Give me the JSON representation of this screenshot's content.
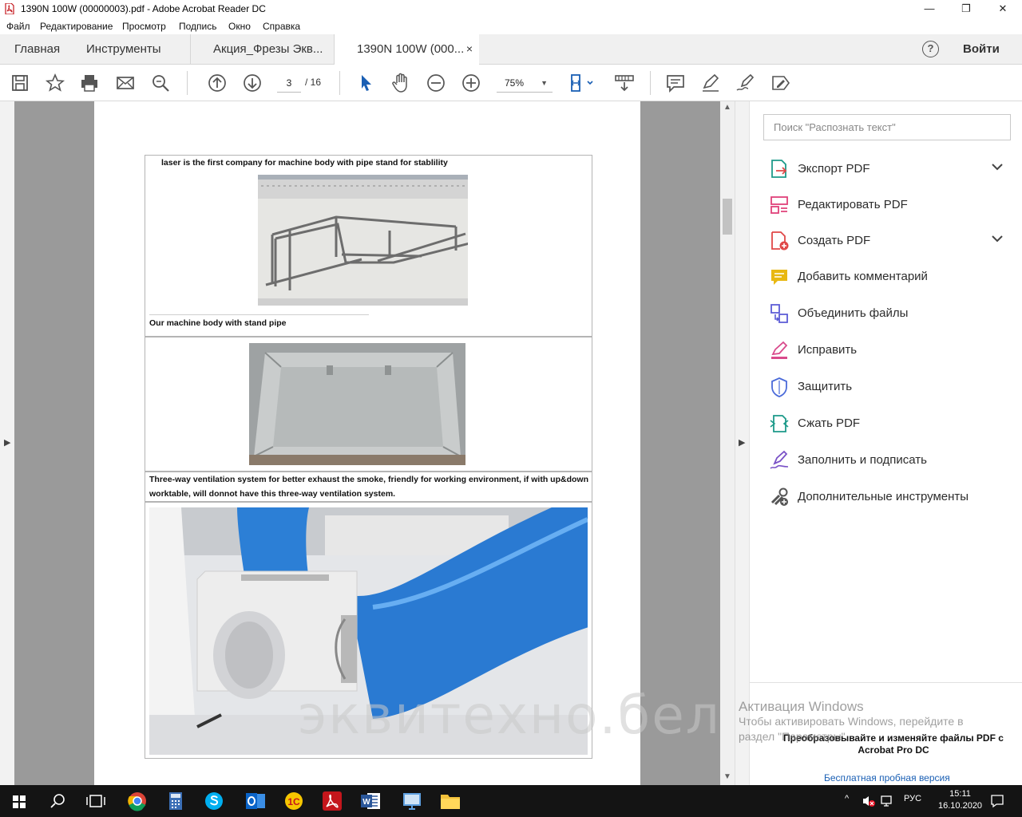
{
  "window": {
    "title": "1390N 100W (00000003).pdf - Adobe Acrobat Reader DC",
    "minimize": "—",
    "maximize": "❐",
    "close": "✕"
  },
  "menu": [
    "Файл",
    "Редактирование",
    "Просмотр",
    "Подпись",
    "Окно",
    "Справка"
  ],
  "tabs": {
    "home": "Главная",
    "tools": "Инструменты",
    "doc1": "Акция_Фрезы Экв...",
    "doc2": "1390N 100W (000...",
    "close": "×",
    "help": "?",
    "signin": "Войти"
  },
  "toolbar": {
    "page_current": "3",
    "page_total": "/ 16",
    "zoom": "75%",
    "zoom_caret": "▼"
  },
  "document": {
    "caption1": "laser is the first company for machine body with pipe stand for stablility",
    "caption2": "Our machine body with stand pipe",
    "caption3": "Three-way ventilation system for better exhaust the smoke, friendly for working environment, if with up&down worktable, will donnot have this three-way ventilation system.",
    "watermark": "эквитехно.бел"
  },
  "right_panel": {
    "search_placeholder": "Поиск \"Распознать текст\"",
    "tools": [
      {
        "label": "Экспорт PDF",
        "icon": "export-pdf-icon",
        "color": "#1d9a8a"
      },
      {
        "label": "Редактировать PDF",
        "icon": "edit-pdf-icon",
        "color": "#e0427a"
      },
      {
        "label": "Создать PDF",
        "icon": "create-pdf-icon",
        "color": "#e04848"
      },
      {
        "label": "Добавить комментарий",
        "icon": "comment-icon",
        "color": "#e8b812"
      },
      {
        "label": "Объединить файлы",
        "icon": "combine-files-icon",
        "color": "#5b5bd6"
      },
      {
        "label": "Исправить",
        "icon": "redact-icon",
        "color": "#d94a8c"
      },
      {
        "label": "Защитить",
        "icon": "protect-icon",
        "color": "#4a6ad9"
      },
      {
        "label": "Сжать PDF",
        "icon": "compress-pdf-icon",
        "color": "#1d9a8a"
      },
      {
        "label": "Заполнить и подписать",
        "icon": "fill-sign-icon",
        "color": "#7a52c7"
      },
      {
        "label": "Дополнительные инструменты",
        "icon": "more-tools-icon",
        "color": "#555555"
      }
    ],
    "promo_text": "Преобразовывайте и изменяйте файлы PDF с Acrobat Pro DC",
    "promo_link": "Бесплатная пробная версия"
  },
  "activation": {
    "title": "Активация Windows",
    "line1": "Чтобы активировать Windows, перейдите в",
    "line2": "раздел \"Параметры\"."
  },
  "taskbar": {
    "lang": "РУС",
    "time": "15:11",
    "date": "16.10.2020"
  },
  "colors": {
    "accent_blue": "#1a5fb4",
    "doc_background": "#9a9a9a",
    "taskbar": "#141414"
  }
}
